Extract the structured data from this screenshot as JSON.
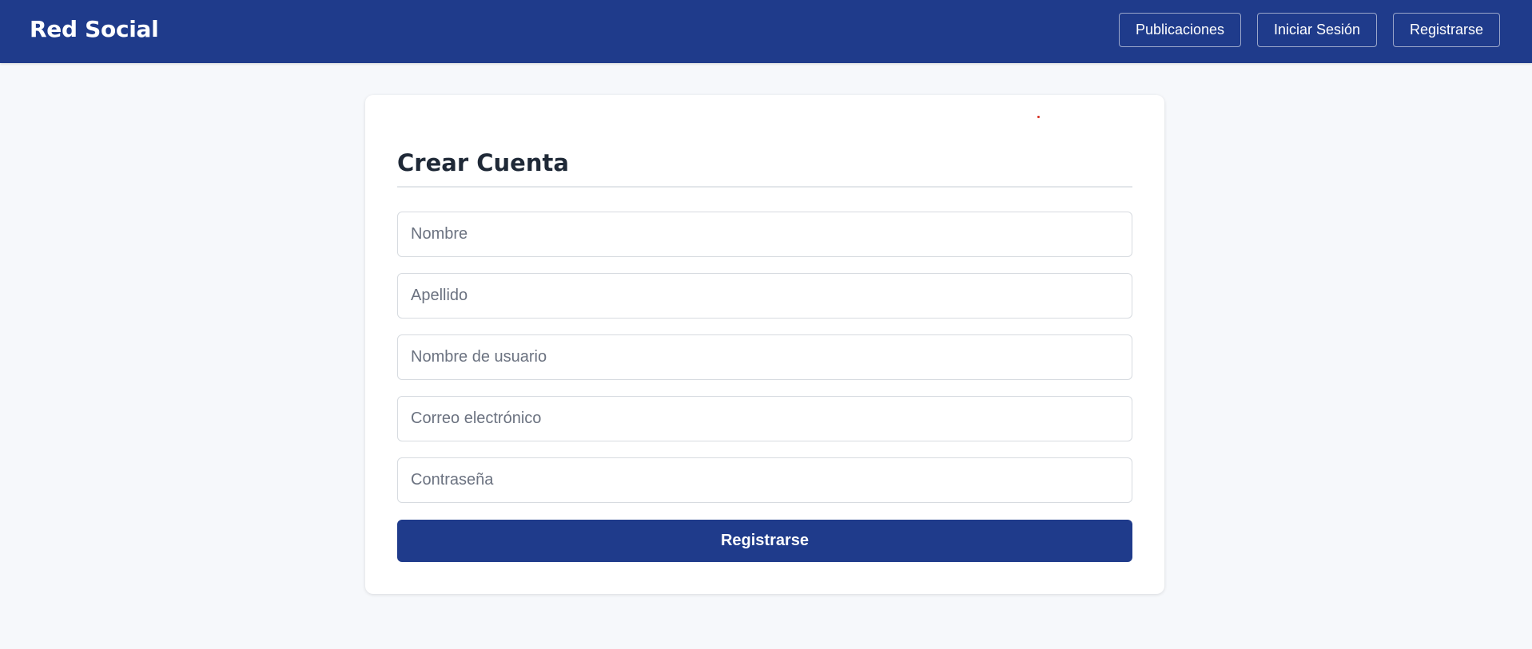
{
  "header": {
    "brand": "Red Social",
    "nav": {
      "publicaciones": "Publicaciones",
      "login": "Iniciar Sesión",
      "register": "Registrarse"
    }
  },
  "form": {
    "title": "Crear Cuenta",
    "fields": {
      "nombre": {
        "placeholder": "Nombre",
        "value": ""
      },
      "apellido": {
        "placeholder": "Apellido",
        "value": ""
      },
      "usuario": {
        "placeholder": "Nombre de usuario",
        "value": ""
      },
      "correo": {
        "placeholder": "Correo electrónico",
        "value": ""
      },
      "contrasena": {
        "placeholder": "Contraseña",
        "value": ""
      }
    },
    "submit_label": "Registrarse"
  },
  "colors": {
    "primary": "#1f3b8b",
    "background": "#f6f8fb",
    "card": "#ffffff",
    "accent_dot": "#d62d20"
  }
}
